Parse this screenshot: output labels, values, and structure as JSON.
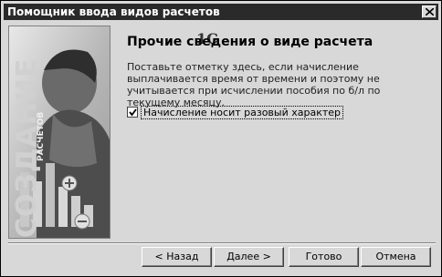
{
  "window": {
    "title": "Помощник ввода видов расчетов"
  },
  "sidebar": {
    "logo_text": "1С",
    "vertical_big": "СОЗДАНИЕ",
    "vertical_small": "РАСЧЕТОВ"
  },
  "main": {
    "heading": "Прочие сведения о виде расчета",
    "description": "Поставьте отметку здесь, если начисление выплачивается время от времени и поэтому не учитывается при исчислении пособия по б/л по текущему месяцу.",
    "checkbox": {
      "label": "Начисление носит разовый характер",
      "checked": true
    }
  },
  "footer": {
    "back_label": "< Назад",
    "next_label": "Далее >",
    "done_label": "Готово",
    "cancel_label": "Отмена"
  }
}
